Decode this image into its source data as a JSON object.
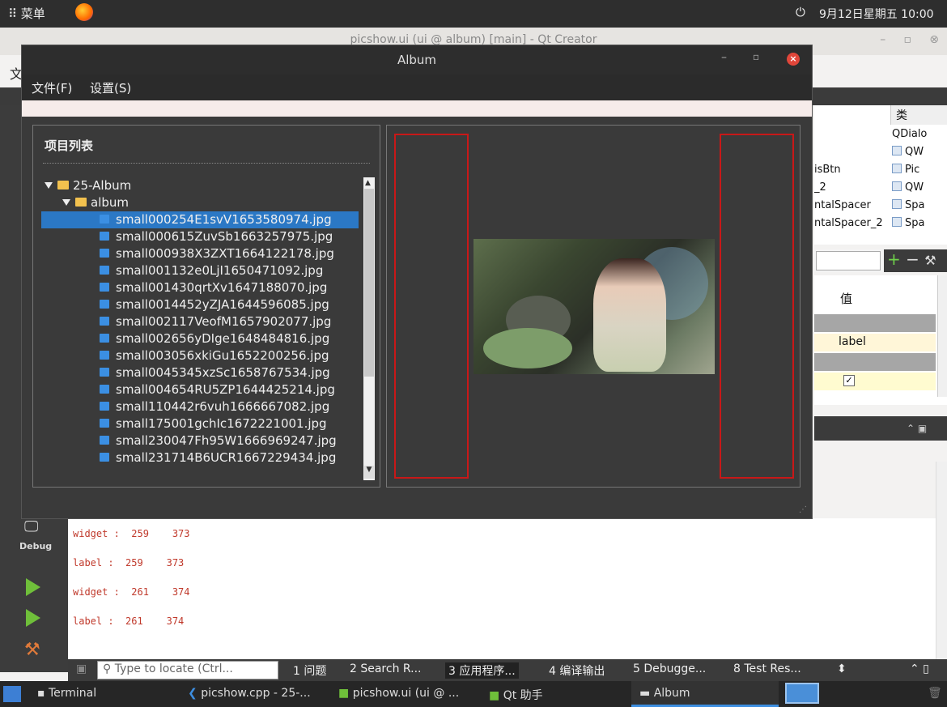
{
  "top_panel": {
    "menu_label": "⠿ 菜单",
    "clock": "9月12日星期五 10:00"
  },
  "qt_creator": {
    "caption": "picshow.ui (ui @ album) [main] - Qt Creator",
    "menu_char": "文",
    "mode_label": "Debug",
    "class_header": "类",
    "object_rows": [
      {
        "name": "",
        "class": "QDialo"
      },
      {
        "name": "",
        "class": "QW"
      },
      {
        "name": "isBtn",
        "class": "Pic"
      },
      {
        "name": "_2",
        "class": "QW"
      },
      {
        "name": "ntalSpacer",
        "class": "Spa"
      },
      {
        "name": "ntalSpacer_2",
        "class": "Spa"
      }
    ],
    "value_header": "值",
    "label_value": "label",
    "checkbox_mark": "✓",
    "output_lines": [
      "widget :  259    373",
      "label :  259    373",
      "widget :  261    374",
      "label :  261    374"
    ],
    "locate_placeholder": "Type to locate (Ctrl...",
    "bottom_tabs": [
      "1 问题",
      "2 Search R...",
      "3 应用程序...",
      "4 编译输出",
      "5 Debugge...",
      "8 Test Res..."
    ]
  },
  "album": {
    "title": "Album",
    "menu": [
      "文件(F)",
      "设置(S)"
    ],
    "tree_header": "项目列表",
    "root_folder": "25-Album",
    "sub_folder": "album",
    "files": [
      "small000254E1svV1653580974.jpg",
      "small000615ZuvSb1663257975.jpg",
      "small000938X3ZXT1664122178.jpg",
      "small001132e0LjI1650471092.jpg",
      "small001430qrtXv1647188070.jpg",
      "small0014452yZJA1644596085.jpg",
      "small002117VeofM1657902077.jpg",
      "small002656yDIge1648484816.jpg",
      "small003056xkiGu1652200256.jpg",
      "small0045345xzSc1658767534.jpg",
      "small004654RU5ZP1644425214.jpg",
      "small110442r6vuh1666667082.jpg",
      "small175001gchIc1672221001.jpg",
      "small230047Fh95W1666969247.jpg",
      "small231714B6UCR1667229434.jpg"
    ],
    "selected_index": 0
  },
  "taskbar": {
    "items": [
      "Terminal",
      "picshow.cpp - 25-...",
      "picshow.ui (ui @ ...",
      "Qt 助手",
      "Album"
    ]
  }
}
